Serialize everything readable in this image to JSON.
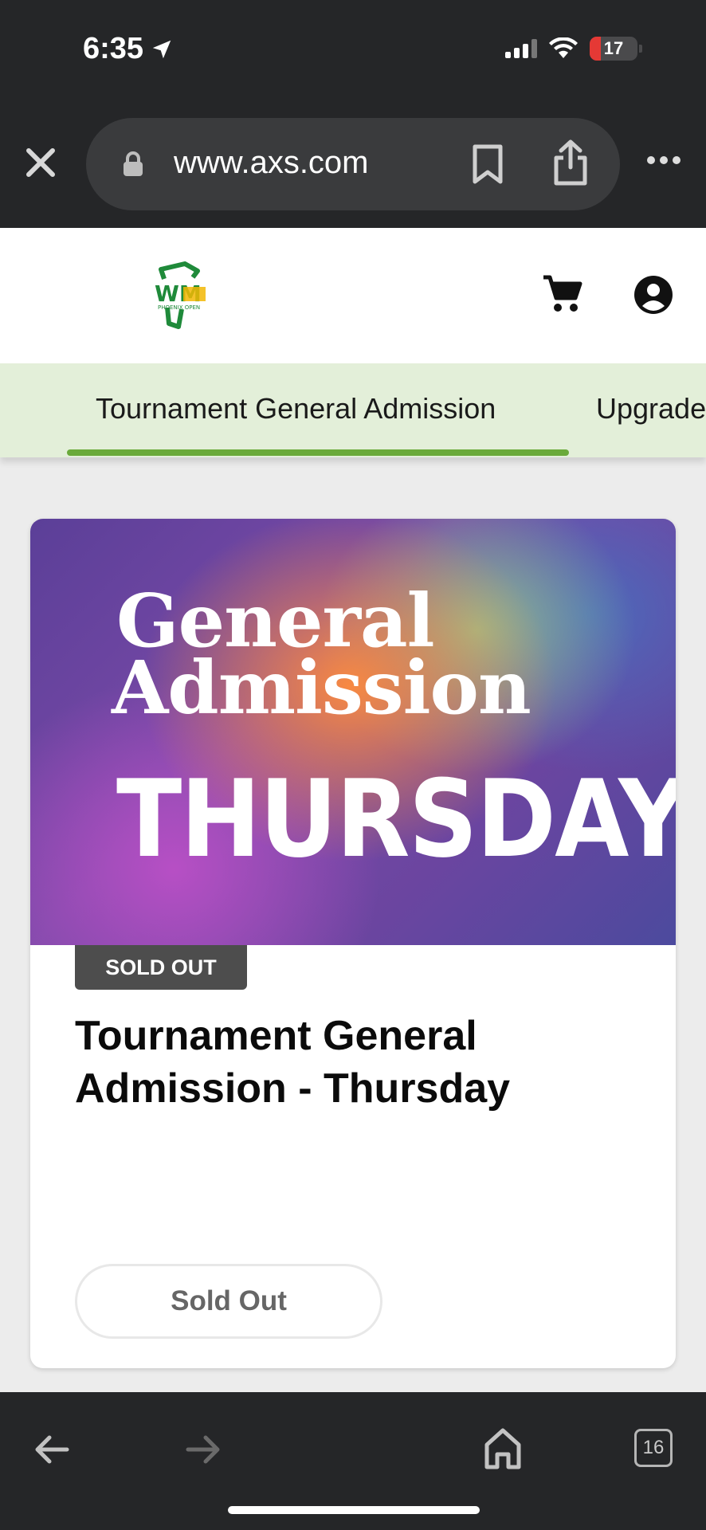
{
  "status_bar": {
    "time": "6:35",
    "battery": "17"
  },
  "browser": {
    "url": "www.axs.com",
    "tab_count": "16"
  },
  "site": {
    "logo_text": "WM",
    "logo_sub": "PHOENIX OPEN"
  },
  "tabs": [
    {
      "label": "Tournament General Admission",
      "active": true
    },
    {
      "label": "Upgrade",
      "active": false
    }
  ],
  "card": {
    "hero_line1": "General",
    "hero_line2": "Admission",
    "hero_line3": "THURSDAY",
    "badge": "SOLD OUT",
    "title": "Tournament General Admission - Thursday",
    "button_label": "Sold Out"
  },
  "colors": {
    "chrome_bg": "#252628",
    "tab_bar_bg": "#e3efd9",
    "tab_underline": "#6aaa3a",
    "badge_bg": "#4d4d4d",
    "battery_low": "#e53935"
  },
  "icons": [
    "location-arrow-icon",
    "signal-icon",
    "wifi-icon",
    "battery-icon",
    "close-icon",
    "lock-icon",
    "bookmark-icon",
    "share-icon",
    "more-icon",
    "cart-icon",
    "account-icon",
    "back-icon",
    "forward-icon",
    "home-icon",
    "tabs-icon"
  ]
}
